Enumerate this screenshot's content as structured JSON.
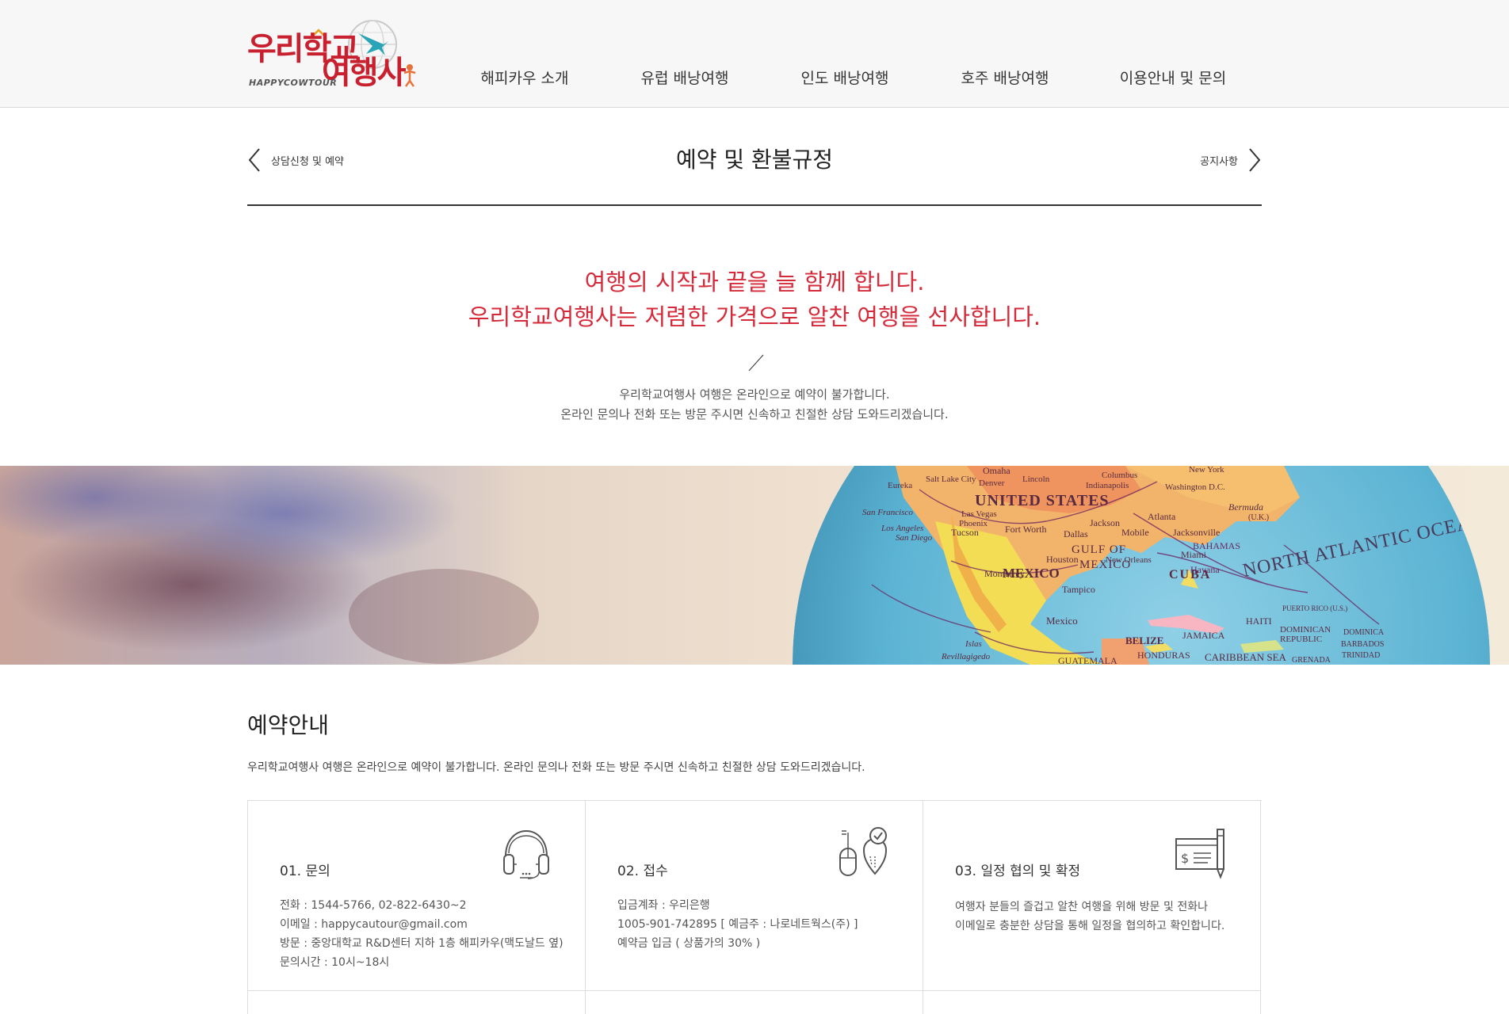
{
  "header": {
    "logo": {
      "line1": "우리학교",
      "line2": "여행사",
      "sub": "HAPPYCOWTOUR"
    },
    "nav": [
      {
        "label": "해피카우 소개"
      },
      {
        "label": "유럽 배낭여행"
      },
      {
        "label": "인도 배낭여행"
      },
      {
        "label": "호주 배낭여행"
      },
      {
        "label": "이용안내 및 문의"
      }
    ]
  },
  "page": {
    "prev_label": "상담신청 및 예약",
    "title": "예약 및 환불규정",
    "next_label": "공지사항"
  },
  "intro": {
    "line1": "여행의 시작과 끝을 늘 함께 합니다.",
    "line2": "우리학교여행사는 저렴한 가격으로 알찬 여행을 선사합니다.",
    "sub1": "우리학교여행사 여행은 온라인으로 예약이 불가합니다.",
    "sub2": "온라인 문의나 전화 또는 방문 주시면 신속하고 친절한 상담 도와드리겠습니다."
  },
  "banner": {
    "labels": {
      "us": "UNITED STATES",
      "mexico": "MEXICO",
      "gulf1": "GULF OF",
      "gulf2": "MEXICO",
      "atlantic": "NORTH ATLANTIC OCEAN",
      "cuba": "CUBA",
      "bahamas": "BAHAMAS",
      "jamaica": "JAMAICA",
      "haiti": "HAITI",
      "belize": "BELIZE",
      "honduras": "HONDURAS",
      "guatemala": "GUATEMALA",
      "caribbean": "CARIBBEAN SEA",
      "dominican": "DOMINICAN",
      "republic": "REPUBLIC",
      "dominica": "DOMINICA",
      "barbados": "BARBADOS",
      "trinidad": "TRINIDAD",
      "grenada": "GRENADA",
      "puerto_rico": "PUERTO RICO (U.S.)",
      "bermuda": "Bermuda",
      "uk": "(U.K.)",
      "omaha": "Omaha",
      "lincoln": "Lincoln",
      "columbus": "Columbus",
      "indianapolis": "Indianapolis",
      "newyork": "New York",
      "washington": "Washington D.C.",
      "denver": "Denver",
      "saltlake": "Salt Lake City",
      "eureka": "Eureka",
      "sanfrancisco": "San Francisco",
      "lasvegas": "Las Vegas",
      "phoenix": "Phoenix",
      "losangeles": "Los Angeles",
      "sandiego": "San Diego",
      "tucson": "Tucson",
      "fortworth": "Fort Worth",
      "dallas": "Dallas",
      "jackson": "Jackson",
      "atlanta": "Atlanta",
      "mobile": "Mobile",
      "jacksonville": "Jacksonville",
      "houston": "Houston",
      "neworleans": "New Orleans",
      "miami": "Miami",
      "havana": "Havana",
      "monterrey": "Monterrey",
      "tampico": "Tampico",
      "mexicocity": "Mexico",
      "islas": "Islas",
      "revillagigedo": "Revillagigedo"
    }
  },
  "guide": {
    "title": "예약안내",
    "desc": "우리학교여행사 여행은 온라인으로 예약이 불가합니다. 온라인 문의나 전화 또는 방문 주시면 신속하고 친절한 상담 도와드리겠습니다.",
    "cards": [
      {
        "title": "01. 문의",
        "icon": "headset-icon",
        "lines": [
          "전화 : 1544-5766, 02-822-6430~2",
          "이메일 : happycautour@gmail.com",
          "방문 : 중앙대학교 R&D센터 지하 1층 해피카우(맥도날드 옆)",
          "문의시간 : 10시~18시"
        ]
      },
      {
        "title": "02. 접수",
        "icon": "mouse-location-icon",
        "lines": [
          "입금계좌 : 우리은행",
          "1005-901-742895 [ 예금주 : 나로네트웍스(주) ]",
          "예약금 입금 ( 상품가의 30% )"
        ]
      },
      {
        "title": "03. 일정 협의 및 확정",
        "icon": "check-document-icon",
        "lines": [
          "여행자 분들의 즐겁고 알찬 여행을 위해 방문 및 전화나",
          "이메일로 충분한 상담을 통해 일정을 협의하고 확인합니다."
        ]
      }
    ]
  }
}
